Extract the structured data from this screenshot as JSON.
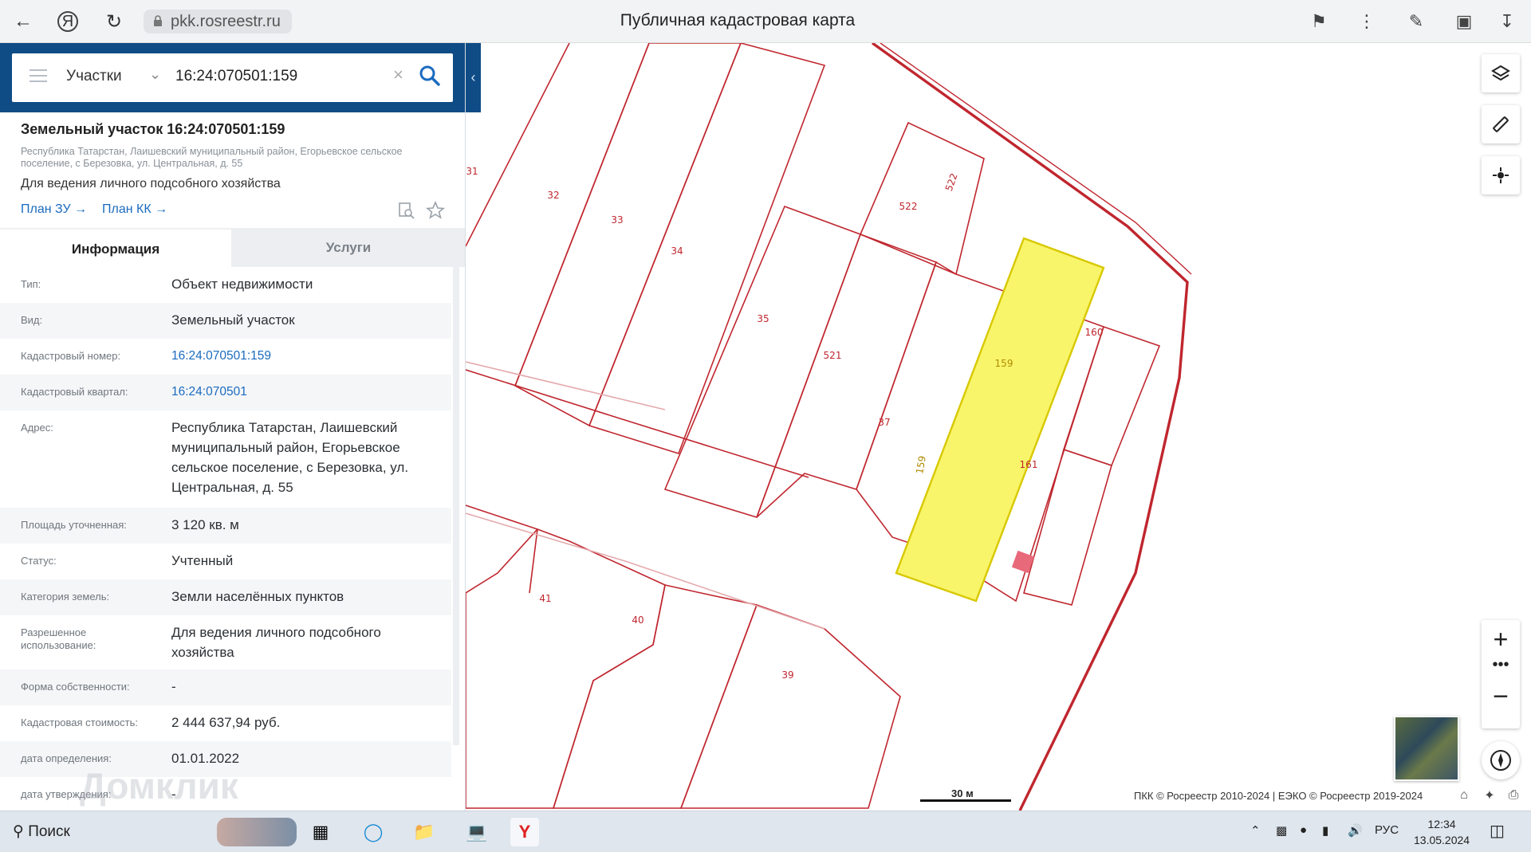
{
  "browser": {
    "url": "pkk.rosreestr.ru",
    "title": "Публичная кадастровая карта"
  },
  "search": {
    "category": "Участки",
    "query": "16:24:070501:159"
  },
  "object": {
    "title": "Земельный участок 16:24:070501:159",
    "address": "Республика Татарстан, Лаишевский муниципальный район, Егорьевское сельское поселение, с Березовка, ул. Центральная, д. 55",
    "purpose": "Для ведения личного подсобного хозяйства",
    "plan_zu": "План ЗУ →",
    "plan_kk": "План КК →"
  },
  "tabs": {
    "info": "Информация",
    "services": "Услуги"
  },
  "rows": [
    {
      "label": "Тип:",
      "value": "Объект недвижимости"
    },
    {
      "label": "Вид:",
      "value": "Земельный участок"
    },
    {
      "label": "Кадастровый номер:",
      "value": "16:24:070501:159"
    },
    {
      "label": "Кадастровый квартал:",
      "value": "16:24:070501"
    },
    {
      "label": "Адрес:",
      "value": "Республика Татарстан, Лаишевский муниципальный район, Егорьевское сельское поселение, с Березовка, ул. Центральная, д. 55"
    },
    {
      "label": "Площадь уточненная:",
      "value": "3 120 кв. м"
    },
    {
      "label": "Статус:",
      "value": "Учтенный"
    },
    {
      "label": "Категория земель:",
      "value": "Земли населённых пунктов"
    },
    {
      "label": "Разрешенное использование:",
      "value": "Для ведения личного подсобного хозяйства"
    },
    {
      "label": "Форма собственности:",
      "value": "-"
    },
    {
      "label": "Кадастровая стоимость:",
      "value": "2 444 637,94 руб."
    },
    {
      "label": "дата определения:",
      "value": "01.01.2022"
    },
    {
      "label": "дата утверждения:",
      "value": "-"
    }
  ],
  "watermark": "Домклик",
  "map": {
    "parcel_labels": [
      "31",
      "32",
      "33",
      "34",
      "35",
      "521",
      "522",
      "522",
      "37",
      "159",
      "159",
      "160",
      "161",
      "41",
      "40",
      "39"
    ],
    "scale": "30 м",
    "copyright": "ПКК © Росреестр 2010-2024 | ЕЭКО © Росреестр 2019-2024",
    "colors": {
      "boundary": "#c0262e",
      "selected_fill": "#f8f56a",
      "selected_stroke": "#d8c800"
    }
  },
  "taskbar": {
    "search": "Поиск",
    "lang": "РУС",
    "time": "12:34",
    "date": "13.05.2024"
  }
}
